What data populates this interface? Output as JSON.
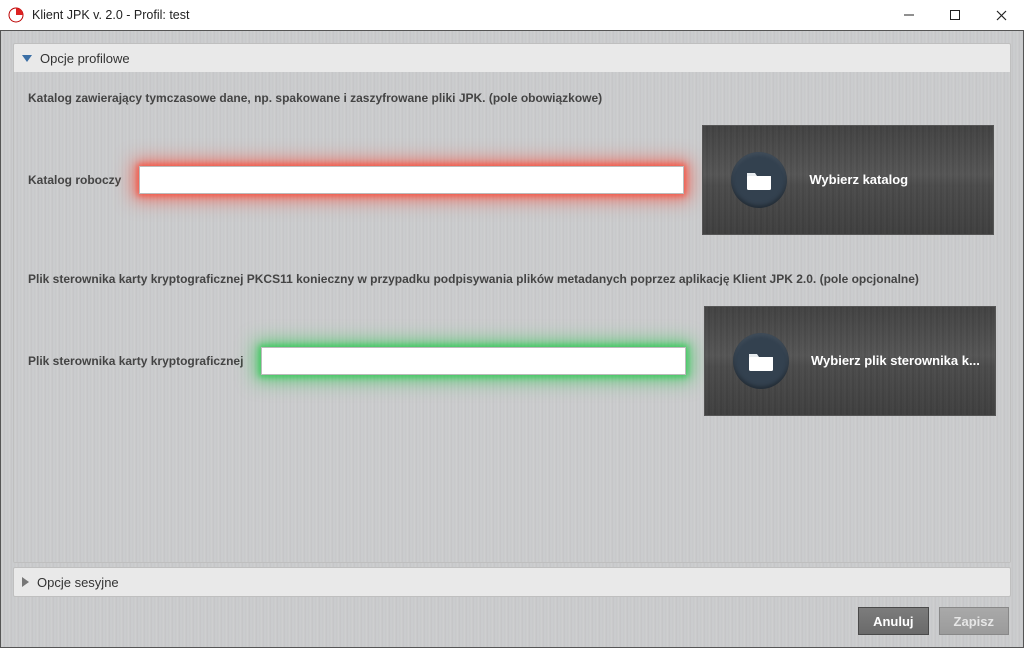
{
  "window": {
    "title": "Klient JPK v. 2.0 - Profil: test"
  },
  "sections": {
    "profile": {
      "title": "Opcje profilowe",
      "katalog_desc": "Katalog zawierający tymczasowe dane, np. spakowane i zaszyfrowane pliki JPK. (pole obowiązkowe)",
      "katalog_label": "Katalog roboczy",
      "katalog_value": "",
      "btn_choose_dir": "Wybierz katalog",
      "driver_desc": "Plik sterownika karty kryptograficznej PKCS11 konieczny w przypadku podpisywania plików metadanych poprzez aplikację Klient JPK 2.0. (pole opcjonalne)",
      "driver_label": "Plik sterownika karty kryptograficznej",
      "driver_value": "",
      "btn_choose_driver": "Wybierz plik sterownika k..."
    },
    "session": {
      "title": "Opcje sesyjne"
    }
  },
  "footer": {
    "cancel": "Anuluj",
    "save": "Zapisz"
  },
  "colors": {
    "glow_invalid": "#ff3c28",
    "glow_valid": "#1ec846",
    "icon_bg": "#33414f"
  }
}
